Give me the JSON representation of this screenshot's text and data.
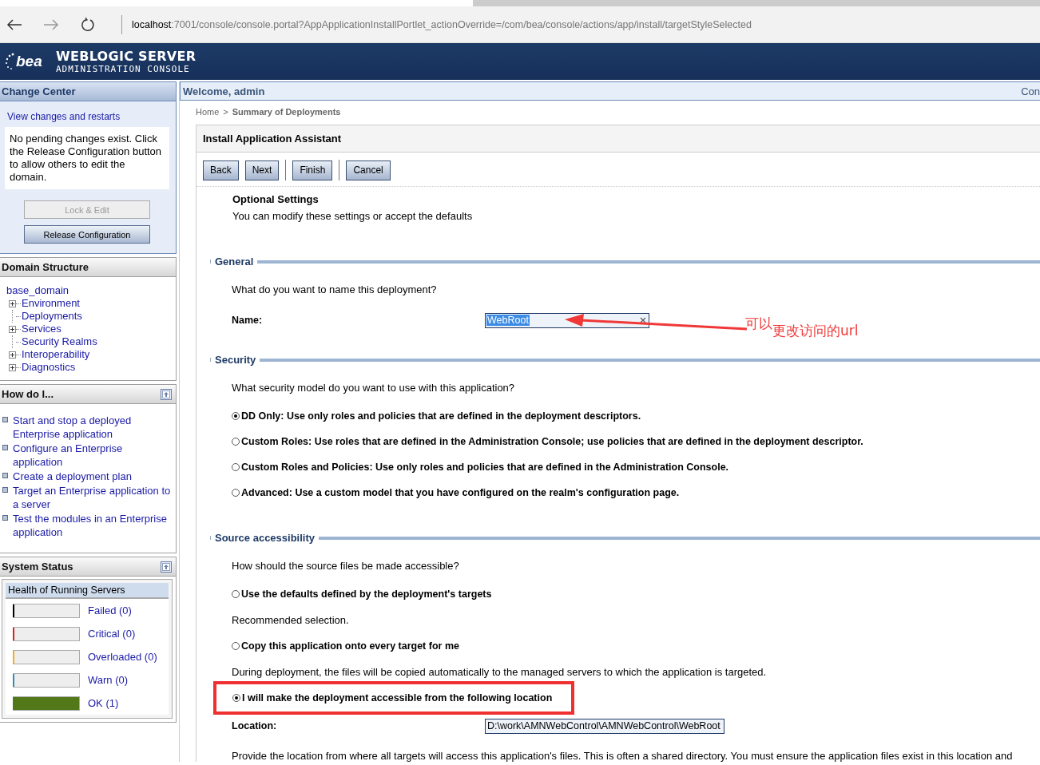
{
  "browser": {
    "url_host": "localhost",
    "url_rest": ":7001/console/console.portal?AppApplicationInstallPortlet_actionOverride=/com/bea/console/actions/app/install/targetStyleSelected"
  },
  "header": {
    "logo": "bea",
    "title": "WEBLOGIC SERVER",
    "subtitle": "ADMINISTRATION CONSOLE"
  },
  "change_center": {
    "title": "Change Center",
    "link": "View changes and restarts",
    "message": "No pending changes exist. Click the Release Configuration button to allow others to edit the domain.",
    "buttons": [
      {
        "label": "Lock & Edit",
        "disabled": true
      },
      {
        "label": "Release Configuration",
        "disabled": false
      }
    ]
  },
  "domain_structure": {
    "title": "Domain Structure",
    "root": "base_domain",
    "children": [
      {
        "label": "Environment",
        "expandable": true
      },
      {
        "label": "Deployments",
        "expandable": false
      },
      {
        "label": "Services",
        "expandable": true
      },
      {
        "label": "Security Realms",
        "expandable": false
      },
      {
        "label": "Interoperability",
        "expandable": true
      },
      {
        "label": "Diagnostics",
        "expandable": true
      }
    ]
  },
  "how_do_i": {
    "title": "How do I...",
    "links": [
      "Start and stop a deployed Enterprise application",
      "Configure an Enterprise application",
      "Create a deployment plan",
      "Target an Enterprise application to a server",
      "Test the modules in an Enterprise application"
    ]
  },
  "system_status": {
    "title": "System Status",
    "subtitle": "Health of Running Servers",
    "rows": [
      {
        "label": "Failed (0)",
        "color": "#000000",
        "level": 0
      },
      {
        "label": "Critical (0)",
        "color": "#e02020",
        "level": 0
      },
      {
        "label": "Overloaded (0)",
        "color": "#f0b020",
        "level": 0
      },
      {
        "label": "Warn (0)",
        "color": "#3090b0",
        "level": 0
      },
      {
        "label": "OK (1)",
        "color": "#52781a",
        "level": 1
      }
    ]
  },
  "welcome": {
    "text": "Welcome, admin",
    "right": "Con"
  },
  "breadcrumb": [
    {
      "label": "Home",
      "current": false
    },
    {
      "separator": ">",
      "label": "Summary of Deployments",
      "current": true
    }
  ],
  "assistant": {
    "title": "Install Application Assistant",
    "buttons": [
      "Back",
      "Next",
      "Finish",
      "Cancel"
    ],
    "heading": "Optional Settings",
    "intro": "You can modify these settings or accept the defaults",
    "sections": [
      {
        "title": "General",
        "items": [
          {
            "kind": "question",
            "text": "What do you want to name this deployment?"
          },
          {
            "kind": "field",
            "label": "Name:",
            "value": "WebRoot",
            "value_selected": true,
            "clearable": true
          }
        ]
      },
      {
        "title": "Security",
        "items": [
          {
            "kind": "question",
            "text": "What security model do you want to use with this application?"
          },
          {
            "kind": "radio",
            "label": "DD Only: Use only roles and policies that are defined in the deployment descriptors.",
            "selected": true,
            "highlighted": false
          },
          {
            "kind": "radio",
            "label": "Custom Roles: Use roles that are defined in the Administration Console; use policies that are defined in the deployment descriptor.",
            "selected": false,
            "highlighted": false
          },
          {
            "kind": "radio",
            "label": "Custom Roles and Policies: Use only roles and policies that are defined in the Administration Console.",
            "selected": false,
            "highlighted": false
          },
          {
            "kind": "radio",
            "label": "Advanced: Use a custom model that you have configured on the realm's configuration page.",
            "selected": false,
            "highlighted": false
          }
        ]
      },
      {
        "title": "Source accessibility",
        "items": [
          {
            "kind": "question",
            "text": "How should the source files be made accessible?"
          },
          {
            "kind": "radio",
            "label": "Use the defaults defined by the deployment's targets",
            "selected": false,
            "highlighted": false
          },
          {
            "kind": "note",
            "text": "Recommended selection."
          },
          {
            "kind": "radio",
            "label": "Copy this application onto every target for me",
            "selected": false,
            "highlighted": false
          },
          {
            "kind": "note",
            "text": "During deployment, the files will be copied automatically to the managed servers to which the application is targeted."
          },
          {
            "kind": "radio",
            "label": "I will make the deployment accessible from the following location",
            "selected": true,
            "highlighted": true
          },
          {
            "kind": "field",
            "label": "Location:",
            "value": "D:\\work\\AMNWebControl\\AMNWebControl\\WebRoot",
            "value_selected": false,
            "clearable": false
          },
          {
            "kind": "note",
            "text": "Provide the location from where all targets will access this application's files. This is often a shared directory. You must ensure the application files exist in this location and"
          }
        ]
      }
    ]
  },
  "annotation": {
    "parts": [
      "可以",
      "更改访问的url"
    ]
  }
}
